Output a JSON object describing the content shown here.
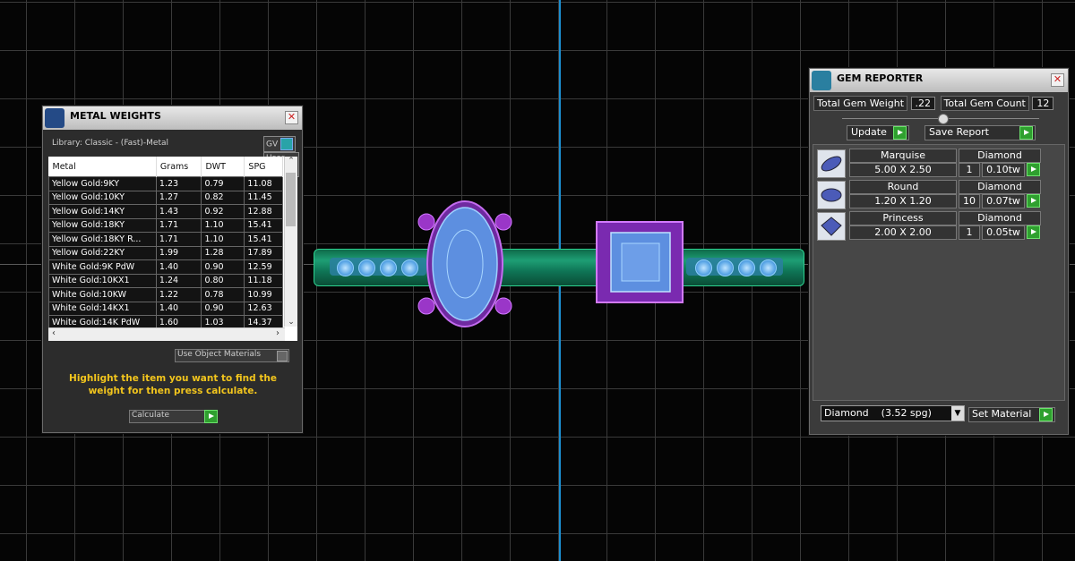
{
  "metal_weights": {
    "title": "METAL WEIGHTS",
    "library": "Library: Classic - (Fast)-Metal",
    "toggle_gv": "GV",
    "toggle_user": "User",
    "columns": [
      "Metal",
      "Grams",
      "DWT",
      "SPG"
    ],
    "rows": [
      [
        "Yellow Gold:9KY",
        "1.23",
        "0.79",
        "11.08"
      ],
      [
        "Yellow Gold:10KY",
        "1.27",
        "0.82",
        "11.45"
      ],
      [
        "Yellow Gold:14KY",
        "1.43",
        "0.92",
        "12.88"
      ],
      [
        "Yellow Gold:18KY",
        "1.71",
        "1.10",
        "15.41"
      ],
      [
        "Yellow Gold:18KY R...",
        "1.71",
        "1.10",
        "15.41"
      ],
      [
        "Yellow Gold:22KY",
        "1.99",
        "1.28",
        "17.89"
      ],
      [
        "White Gold:9K PdW",
        "1.40",
        "0.90",
        "12.59"
      ],
      [
        "White Gold:10KX1",
        "1.24",
        "0.80",
        "11.18"
      ],
      [
        "White Gold:10KW",
        "1.22",
        "0.78",
        "10.99"
      ],
      [
        "White Gold:14KX1",
        "1.40",
        "0.90",
        "12.63"
      ],
      [
        "White Gold:14K PdW",
        "1.60",
        "1.03",
        "14.37"
      ]
    ],
    "use_object_materials": "Use Object Materials",
    "hint": "Highlight the item you want to find the weight for then press calculate.",
    "calculate_label": "Calculate"
  },
  "gem_reporter": {
    "title": "GEM REPORTER",
    "total_weight_label": "Total Gem Weight",
    "total_weight_value": ".22",
    "total_count_label": "Total Gem Count",
    "total_count_value": "12",
    "update_label": "Update",
    "save_report_label": "Save Report",
    "gems": [
      {
        "shape": "Marquise",
        "material": "Diamond",
        "size": "5.00 X 2.50",
        "count": "1",
        "weight": "0.10tw"
      },
      {
        "shape": "Round",
        "material": "Diamond",
        "size": "1.20 X 1.20",
        "count": "10",
        "weight": "0.07tw"
      },
      {
        "shape": "Princess",
        "material": "Diamond",
        "size": "2.00 X 2.00",
        "count": "1",
        "weight": "0.05tw"
      }
    ],
    "material_select": "Diamond    (3.52 spg)",
    "set_material_label": "Set Material"
  },
  "icons": [
    "close-icon",
    "scroll-up-icon",
    "scroll-down-icon",
    "scroll-left-icon",
    "scroll-right-icon",
    "play-icon",
    "dropdown-arrow-icon"
  ]
}
